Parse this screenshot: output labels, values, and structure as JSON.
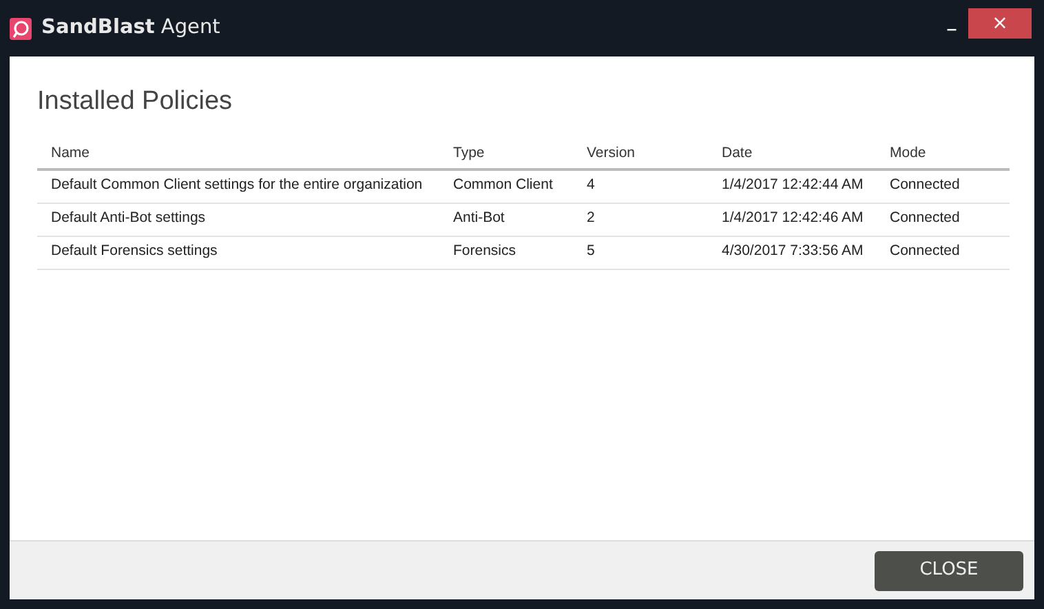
{
  "window": {
    "title": "SandBlast Agent",
    "controls": [
      "–",
      "×"
    ]
  },
  "heading": "Installed Policies",
  "table": {
    "columns": [
      "Name",
      "Type",
      "Version",
      "Date",
      "Mode"
    ],
    "rows": [
      [
        "Default Common Client settings for the entire organization",
        "Common Client",
        "4",
        "1/4/2017 12:42:44 AM",
        "Connected"
      ],
      [
        "Default Anti-Bot settings",
        "Anti-Bot",
        "2",
        "1/4/2017 12:42:46 AM",
        "Connected"
      ],
      [
        "Default Forensics settings",
        "Forensics",
        "5",
        "4/30/2017 7:33:56 AM",
        "Connected"
      ]
    ]
  },
  "buttons": [
    "CLOSE"
  ]
}
